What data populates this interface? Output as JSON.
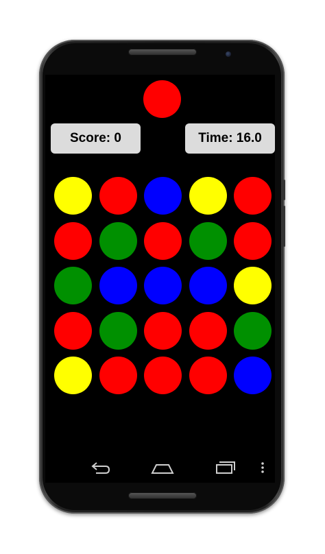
{
  "colors": {
    "red": "#ff0000",
    "green": "#009000",
    "blue": "#0000ff",
    "yellow": "#ffff00",
    "panel": "#dcdcdc"
  },
  "game": {
    "target_color": "red",
    "score_text": "Score: 0",
    "time_text": "Time: 16.0",
    "board": [
      [
        "yellow",
        "red",
        "blue",
        "yellow",
        "red"
      ],
      [
        "red",
        "green",
        "red",
        "green",
        "red"
      ],
      [
        "green",
        "blue",
        "blue",
        "blue",
        "yellow"
      ],
      [
        "red",
        "green",
        "red",
        "red",
        "green"
      ],
      [
        "yellow",
        "red",
        "red",
        "red",
        "blue"
      ]
    ]
  },
  "navbar": {
    "buttons": [
      "back-icon",
      "home-icon",
      "recents-icon",
      "overflow-menu-icon"
    ]
  }
}
